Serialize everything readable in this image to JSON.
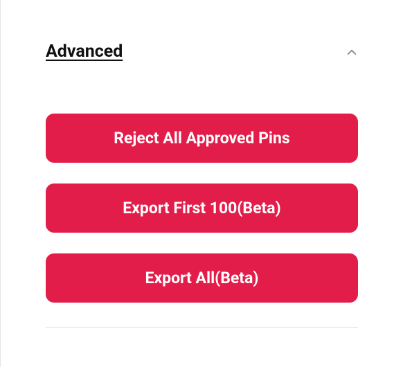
{
  "section": {
    "title": "Advanced",
    "expanded": true
  },
  "buttons": {
    "reject_all": "Reject All Approved Pins",
    "export_first": "Export First 100(Beta)",
    "export_all": "Export All(Beta)"
  },
  "colors": {
    "accent": "#e21d4a"
  }
}
